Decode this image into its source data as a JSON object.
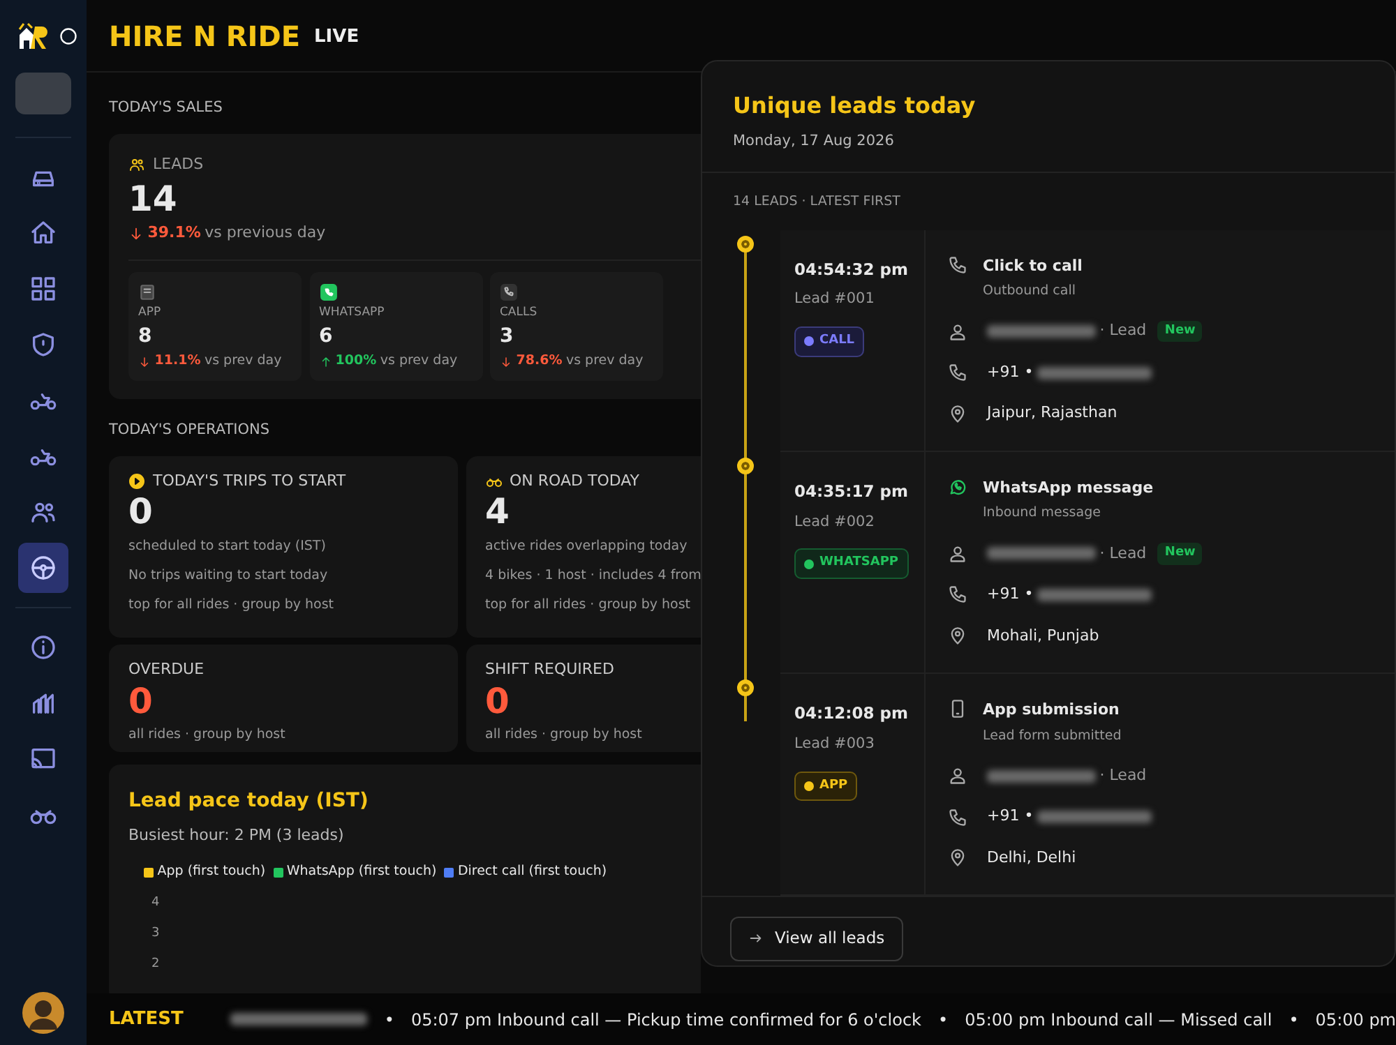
{
  "sidebar": {
    "items": [
      {
        "selected": false
      },
      {
        "selected": false
      },
      {
        "selected": false
      },
      {
        "selected": false
      },
      {
        "selected": false
      },
      {
        "selected": false
      },
      {
        "selected": false
      },
      {
        "selected": true
      },
      {
        "selected": false
      },
      {
        "selected": false
      },
      {
        "selected": false
      },
      {
        "selected": false
      }
    ]
  },
  "header": {
    "title": "HIRE N RIDE",
    "badge": "LIVE"
  },
  "sales": {
    "heading": "TODAY'S SALES",
    "leads": {
      "label": "LEADS",
      "value": "14",
      "increase": false,
      "delta": "39.1%",
      "note": "vs previous day"
    },
    "channels": [
      {
        "kind": "app",
        "label": "APP",
        "value": "8",
        "increase": false,
        "delta": "11.1%",
        "note": "vs prev day"
      },
      {
        "kind": "whatsapp",
        "label": "WHATSAPP",
        "value": "6",
        "increase": true,
        "delta": "100%",
        "note": "vs prev day"
      },
      {
        "kind": "calls",
        "label": "CALLS",
        "value": "3",
        "increase": false,
        "delta": "78.6%",
        "note": "vs prev day"
      }
    ]
  },
  "operations": {
    "heading": "TODAY'S OPERATIONS",
    "cards": [
      {
        "kind": "trips",
        "label": "TODAY'S TRIPS TO START",
        "value": "0",
        "alert": false,
        "lines": [
          "scheduled to start today (IST)",
          "No trips waiting to start today",
          "top for all rides · group by host"
        ]
      },
      {
        "kind": "onroad",
        "label": "ON ROAD TODAY",
        "value": "4",
        "alert": false,
        "lines": [
          "active rides overlapping today",
          "4 bikes · 1 host · includes 4 from",
          "top for all rides · group by host"
        ]
      },
      {
        "kind": "plain",
        "label": "OVERDUE",
        "value": "0",
        "alert": true,
        "lines": [
          "all rides · group by host"
        ]
      },
      {
        "kind": "plain",
        "label": "SHIFT REQUIRED",
        "value": "0",
        "alert": true,
        "lines": [
          "all rides · group by host"
        ]
      }
    ]
  },
  "lead_pace": {
    "title": "Lead pace today (IST)",
    "subtitle": "Busiest hour: 2 PM (3 leads)",
    "legend": [
      {
        "label": "App (first touch)",
        "color": "#f5c518"
      },
      {
        "label": "WhatsApp (first touch)",
        "color": "#22c55e"
      },
      {
        "label": "Direct call (first touch)",
        "color": "#4f7df5"
      }
    ],
    "y_labels": [
      "4",
      "3",
      "2"
    ]
  },
  "leads_panel": {
    "title": "Unique leads today",
    "date": "Monday, 17 Aug 2026",
    "count_label": "14 LEADS · LATEST FIRST",
    "leads": [
      {
        "kind": "call",
        "time": "04:54:32 pm",
        "number": "Lead #001",
        "badge": "CALL",
        "channel": "Click to call",
        "detail": "Outbound call",
        "role": "· Lead",
        "tag": "New",
        "phone_prefix": "+91 •",
        "location": "Jaipur, Rajasthan"
      },
      {
        "kind": "whatsapp",
        "time": "04:35:17 pm",
        "number": "Lead #002",
        "badge": "WHATSAPP",
        "channel": "WhatsApp message",
        "detail": "Inbound message",
        "role": "· Lead",
        "tag": "New",
        "phone_prefix": "+91 •",
        "location": "Mohali, Punjab"
      },
      {
        "kind": "app",
        "time": "04:12:08 pm",
        "number": "Lead #003",
        "badge": "APP",
        "channel": "App submission",
        "detail": "Lead form submitted",
        "role": "· Lead",
        "phone_prefix": "+91 •",
        "location": "Delhi, Delhi"
      }
    ],
    "button": "View all leads"
  },
  "ticker": {
    "label": "LATEST",
    "separator": "•",
    "items": [
      {
        "kind": "redacted"
      },
      {
        "kind": "text",
        "text": "05:07 pm Inbound call — Pickup time confirmed for 6 o'clock"
      },
      {
        "kind": "text",
        "text": "05:00 pm Inbound call — Missed call"
      },
      {
        "kind": "text",
        "text": "05:00 pm"
      }
    ]
  }
}
